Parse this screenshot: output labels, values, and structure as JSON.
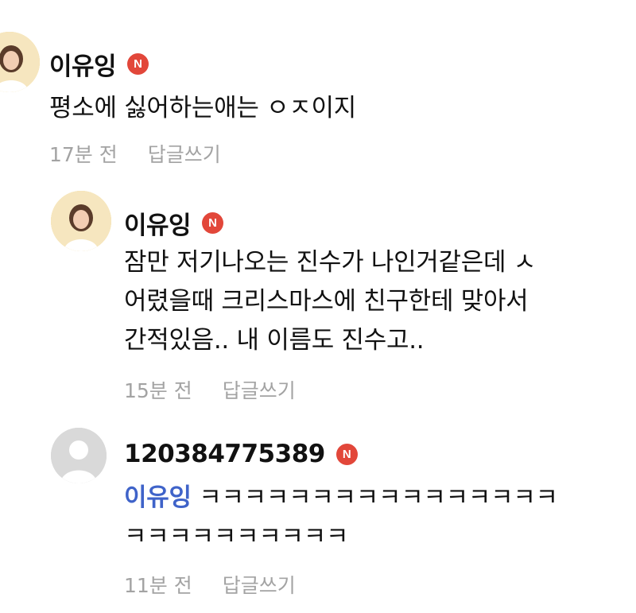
{
  "comments": [
    {
      "author": "이유잉",
      "badge": "N",
      "avatar": "profile-photo",
      "lines": [
        "평소에 싫어하는애는 ㅇㅈ이지"
      ],
      "time": "17분 전",
      "reply": "답글쓰기"
    },
    {
      "author": "이유잉",
      "badge": "N",
      "avatar": "profile-photo",
      "lines": [
        "잠만 저기나오는 진수가 나인거같은데 ㅅ",
        "어렸을때 크리스마스에 친구한테 맞아서",
        "간적있음.. 내 이름도 진수고.."
      ],
      "time": "15분 전",
      "reply": "답글쓰기"
    },
    {
      "author": "120384775389",
      "badge": "N",
      "avatar": "default-user-icon",
      "mention": "이유잉",
      "lines": [
        "ㅋㅋㅋㅋㅋㅋㅋㅋㅋㅋㅋㅋㅋㅋㅋㅋ",
        "ㅋㅋㅋㅋㅋㅋㅋㅋㅋㅋ"
      ],
      "time": "11분 전",
      "reply": "답글쓰기"
    }
  ]
}
